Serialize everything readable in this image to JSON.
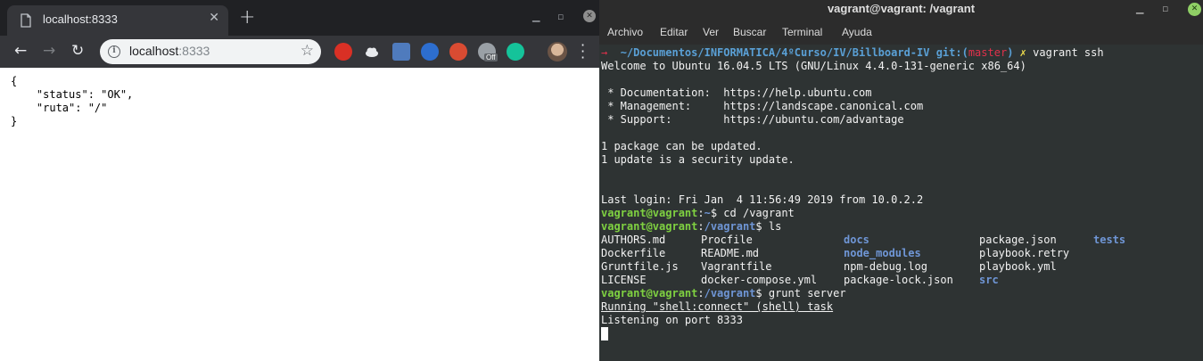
{
  "browser": {
    "tab_title": "localhost:8333",
    "url_host": "localhost",
    "url_port": ":8333",
    "nav": {
      "back": "←",
      "forward": "→",
      "reload": "↻"
    },
    "json_lines": [
      "{",
      "    \"status\": \"OK\",",
      "    \"ruta\": \"/\"",
      "}"
    ],
    "extensions": [
      {
        "name": "adblock-icon",
        "color": "#d93025"
      },
      {
        "name": "cloud-icon",
        "color": "#3d8bfd"
      },
      {
        "name": "screen-icon",
        "color": "#4f7bbd"
      },
      {
        "name": "globe-icon",
        "color": "#2d6ecf"
      },
      {
        "name": "santa-icon",
        "color": "#d94b32"
      },
      {
        "name": "grammarly-icon",
        "color": "#15c39a"
      }
    ],
    "ext_off_badge": "Off"
  },
  "terminal": {
    "title": "vagrant@vagrant: /vagrant",
    "menu": [
      "Archivo",
      "Editar",
      "Ver",
      "Buscar",
      "Terminal",
      "Ayuda"
    ],
    "prompt_path": "~/Documentos/INFORMATICA/4ºCurso/IV/Billboard-IV",
    "git_label": "git:(",
    "git_branch": "master",
    "git_close": ")",
    "dirty_mark": "✗",
    "first_cmd": "vagrant ssh",
    "welcome": "Welcome to Ubuntu 16.04.5 LTS (GNU/Linux 4.4.0-131-generic x86_64)",
    "links": [
      " * Documentation:  https://help.ubuntu.com",
      " * Management:     https://landscape.canonical.com",
      " * Support:        https://ubuntu.com/advantage"
    ],
    "updates": [
      "1 package can be updated.",
      "1 update is a security update."
    ],
    "last_login": "Last login: Fri Jan  4 11:56:49 2019 from 10.0.2.2",
    "vm_user": "vagrant@vagrant",
    "cmd_cd_path": "~",
    "cmd_cd": "$ cd /vagrant",
    "vm_path": "/vagrant",
    "cmd_ls": "$ ls",
    "ls_rows": [
      [
        "AUTHORS.md",
        "Procfile",
        "docs",
        "package.json",
        "tests"
      ],
      [
        "Dockerfile",
        "README.md",
        "node_modules",
        "playbook.retry",
        ""
      ],
      [
        "Gruntfile.js",
        "Vagrantfile",
        "npm-debug.log",
        "playbook.yml",
        ""
      ],
      [
        "LICENSE",
        "docker-compose.yml",
        "package-lock.json",
        "src",
        ""
      ]
    ],
    "cmd_grunt": "$ grunt server",
    "running": "Running \"shell:connect\" (shell) task",
    "listening": "Listening on port 8333"
  }
}
